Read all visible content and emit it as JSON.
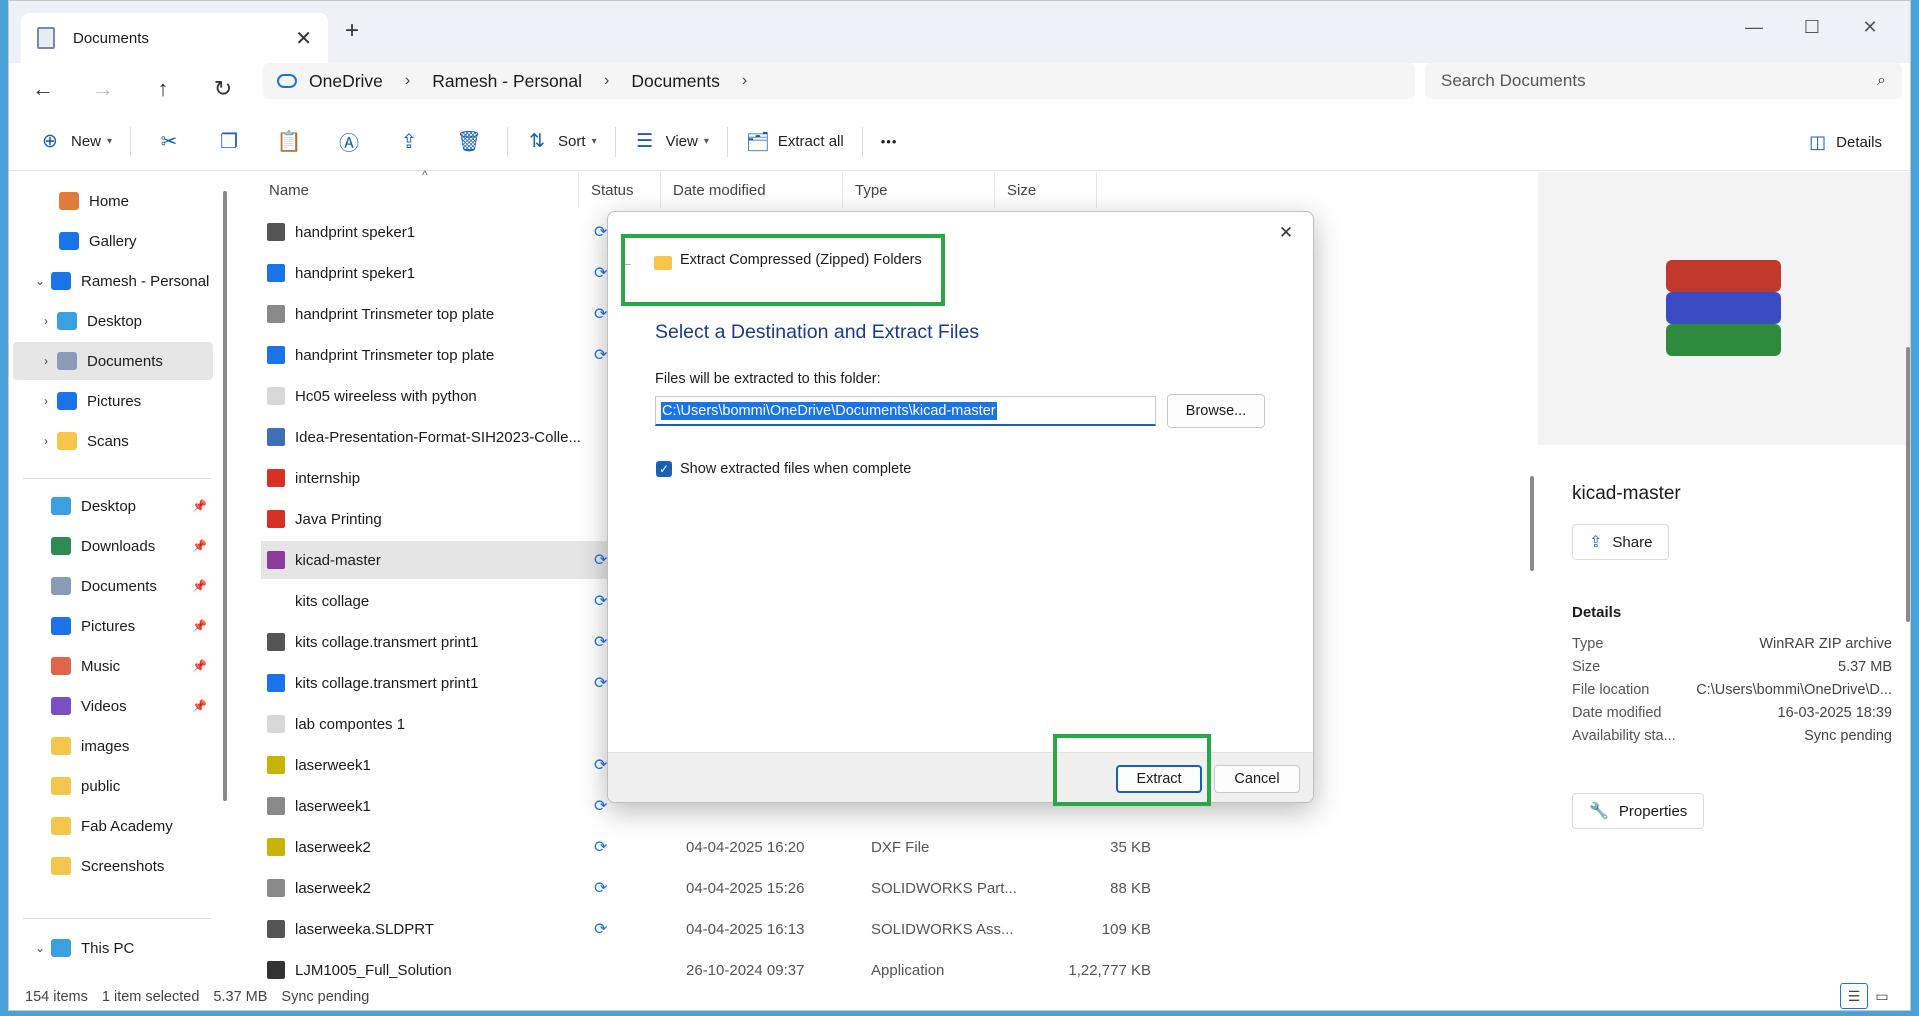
{
  "window": {
    "tab_title": "Documents",
    "tab_close": "✕",
    "new_tab": "+",
    "controls": {
      "minimize": "—",
      "maximize": "☐",
      "close": "✕"
    }
  },
  "nav": {
    "back": "←",
    "forward": "→",
    "up": "↑",
    "refresh": "↻",
    "breadcrumbs": [
      "OneDrive",
      "Ramesh - Personal",
      "Documents"
    ],
    "sep": "›",
    "search_placeholder": "Search Documents",
    "search_icon": "⌕"
  },
  "commands": {
    "new": "New",
    "sort": "Sort",
    "view": "View",
    "extract_all": "Extract all",
    "more": "•••",
    "details": "Details",
    "icons": {
      "new": "⊕",
      "cut": "✂",
      "copy": "❐",
      "paste": "📋",
      "rename": "Ⓐ",
      "share": "⇪",
      "delete": "🗑",
      "sort": "⇅",
      "view": "☰",
      "extract": "🗂",
      "details": "◫"
    }
  },
  "sidebar": {
    "items": [
      {
        "label": "Home",
        "icon": "home-icon",
        "color": "#e07b39",
        "chev": ""
      },
      {
        "label": "Gallery",
        "icon": "gallery-icon",
        "color": "#1a73e8",
        "chev": ""
      },
      {
        "label": "Ramesh - Personal",
        "icon": "onedrive-icon",
        "color": "#1a73e8",
        "chev": "⌄"
      },
      {
        "label": "Desktop",
        "icon": "desktop-icon",
        "color": "#3aa0e0",
        "chev": "›"
      },
      {
        "label": "Documents",
        "icon": "documents-icon",
        "color": "#8a9bb8",
        "chev": "›"
      },
      {
        "label": "Pictures",
        "icon": "pictures-icon",
        "color": "#1a73e8",
        "chev": "›"
      },
      {
        "label": "Scans",
        "icon": "folder-icon",
        "color": "#f4c64b",
        "chev": "›"
      }
    ],
    "quick": [
      {
        "label": "Desktop",
        "icon": "desktop-icon",
        "color": "#3aa0e0"
      },
      {
        "label": "Downloads",
        "icon": "downloads-icon",
        "color": "#2e8b57"
      },
      {
        "label": "Documents",
        "icon": "documents-icon",
        "color": "#8a9bb8"
      },
      {
        "label": "Pictures",
        "icon": "pictures-icon",
        "color": "#1a73e8"
      },
      {
        "label": "Music",
        "icon": "music-icon",
        "color": "#e0654a"
      },
      {
        "label": "Videos",
        "icon": "videos-icon",
        "color": "#7a4fc4"
      },
      {
        "label": "images",
        "icon": "folder-icon",
        "color": "#f4c64b"
      },
      {
        "label": "public",
        "icon": "folder-icon",
        "color": "#f4c64b"
      },
      {
        "label": "Fab Academy",
        "icon": "folder-icon",
        "color": "#f4c64b"
      },
      {
        "label": "Screenshots",
        "icon": "folder-icon",
        "color": "#f4c64b"
      }
    ],
    "this_pc": "This PC",
    "pin": "📌"
  },
  "columns": {
    "name": "Name",
    "status": "Status",
    "date": "Date modified",
    "type": "Type",
    "size": "Size",
    "sort_arrow": "^"
  },
  "files": [
    {
      "name": "handprint speker1",
      "icon_color": "#555",
      "status": "⟳",
      "date": "",
      "type": "",
      "size": ""
    },
    {
      "name": "handprint speker1",
      "icon_color": "#1a73e8",
      "status": "⟳",
      "date": "",
      "type": "",
      "size": ""
    },
    {
      "name": "handprint Trinsmeter top plate",
      "icon_color": "#8a8a8a",
      "status": "⟳",
      "date": "",
      "type": "",
      "size": ""
    },
    {
      "name": "handprint Trinsmeter top plate",
      "icon_color": "#1a73e8",
      "status": "⟳",
      "date": "",
      "type": "",
      "size": ""
    },
    {
      "name": "Hc05 wireeless with python",
      "icon_color": "#d8d8d8",
      "status": "",
      "date": "",
      "type": "",
      "size": ""
    },
    {
      "name": "Idea-Presentation-Format-SIH2023-Colle...",
      "icon_color": "#3d6fb6",
      "status": "",
      "date": "",
      "type": "",
      "size": ""
    },
    {
      "name": "internship",
      "icon_color": "#d93025",
      "status": "",
      "date": "",
      "type": "",
      "size": ""
    },
    {
      "name": "Java Printing",
      "icon_color": "#d93025",
      "status": "",
      "date": "",
      "type": "",
      "size": ""
    },
    {
      "name": "kicad-master",
      "icon_color": "#8e3b9e",
      "status": "⟳",
      "date": "",
      "type": "",
      "size": "",
      "selected": true
    },
    {
      "name": "kits collage",
      "icon_color": "",
      "status": "⟳",
      "date": "",
      "type": "",
      "size": ""
    },
    {
      "name": "kits collage.transmert print1",
      "icon_color": "#555",
      "status": "⟳",
      "date": "",
      "type": "",
      "size": ""
    },
    {
      "name": "kits collage.transmert print1",
      "icon_color": "#1a73e8",
      "status": "⟳",
      "date": "",
      "type": "",
      "size": ""
    },
    {
      "name": "lab compontes 1",
      "icon_color": "#d8d8d8",
      "status": "",
      "date": "",
      "type": "",
      "size": ""
    },
    {
      "name": "laserweek1",
      "icon_color": "#c8b400",
      "status": "⟳",
      "date": "",
      "type": "",
      "size": ""
    },
    {
      "name": "laserweek1",
      "icon_color": "#8a8a8a",
      "status": "⟳",
      "date": "",
      "type": "",
      "size": ""
    },
    {
      "name": "laserweek2",
      "icon_color": "#c8b400",
      "status": "⟳",
      "date": "04-04-2025 16:20",
      "type": "DXF File",
      "size": "35 KB"
    },
    {
      "name": "laserweek2",
      "icon_color": "#8a8a8a",
      "status": "⟳",
      "date": "04-04-2025 15:26",
      "type": "SOLIDWORKS Part...",
      "size": "88 KB"
    },
    {
      "name": "laserweeka.SLDPRT",
      "icon_color": "#555",
      "status": "⟳",
      "date": "04-04-2025 16:13",
      "type": "SOLIDWORKS Ass...",
      "size": "109 KB"
    },
    {
      "name": "LJM1005_Full_Solution",
      "icon_color": "#333",
      "status": "",
      "date": "26-10-2024 09:37",
      "type": "Application",
      "size": "1,22,777 KB"
    }
  ],
  "details": {
    "title": "kicad-master",
    "share": "Share",
    "share_icon": "⇪",
    "heading": "Details",
    "props": [
      {
        "k": "Type",
        "v": "WinRAR ZIP archive"
      },
      {
        "k": "Size",
        "v": "5.37 MB"
      },
      {
        "k": "File location",
        "v": "C:\\Users\\bommi\\OneDrive\\D..."
      },
      {
        "k": "Date modified",
        "v": "16-03-2025 18:39"
      },
      {
        "k": "Availability sta...",
        "v": "Sync pending"
      }
    ],
    "properties": "Properties",
    "properties_icon": "🔧",
    "rar_colors": [
      "#c0392b",
      "#3b4bc4",
      "#2e8b3e"
    ]
  },
  "status": {
    "items": "154 items",
    "selected": "1 item selected",
    "size": "5.37 MB",
    "sync": "Sync pending"
  },
  "dialog": {
    "heading": "Extract Compressed (Zipped) Folders",
    "back": "←",
    "close": "✕",
    "title": "Select a Destination and Extract Files",
    "label": "Files will be extracted to this folder:",
    "path": "C:\\Users\\bommi\\OneDrive\\Documents\\kicad-master",
    "browse": "Browse...",
    "checkbox": "Show extracted files when complete",
    "extract": "Extract",
    "cancel": "Cancel"
  },
  "highlight_color": "#27a745"
}
